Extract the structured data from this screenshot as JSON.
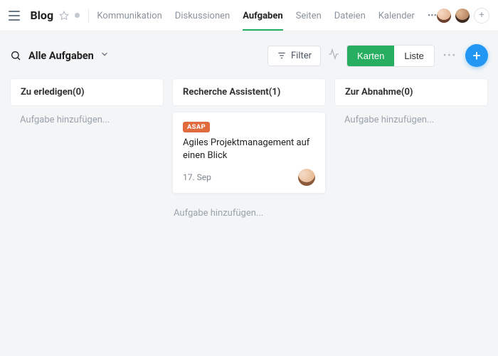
{
  "header": {
    "brand": "Blog",
    "tabs": [
      "Kommunikation",
      "Diskussionen",
      "Aufgaben",
      "Seiten",
      "Dateien",
      "Kalender"
    ],
    "active_tab_index": 2
  },
  "subheader": {
    "title": "Alle Aufgaben",
    "filter_label": "Filter",
    "view_cards": "Karten",
    "view_list": "Liste",
    "active_view": "cards"
  },
  "columns": [
    {
      "title": "Zu erledigen",
      "count": 0,
      "add_placeholder": "Aufgabe hinzufügen...",
      "cards": []
    },
    {
      "title": "Recherche Assistent",
      "count": 1,
      "add_placeholder": "Aufgabe hinzufügen...",
      "cards": [
        {
          "tag": "ASAP",
          "title": "Agiles Projektmanagement auf einen Blick",
          "date": "17. Sep"
        }
      ]
    },
    {
      "title": "Zur Abnahme",
      "count": 0,
      "add_placeholder": "Aufgabe hinzufügen...",
      "cards": []
    }
  ],
  "colors": {
    "accent_green": "#27ae60",
    "accent_blue": "#2196f3",
    "tag_asap": "#e26b3e"
  }
}
